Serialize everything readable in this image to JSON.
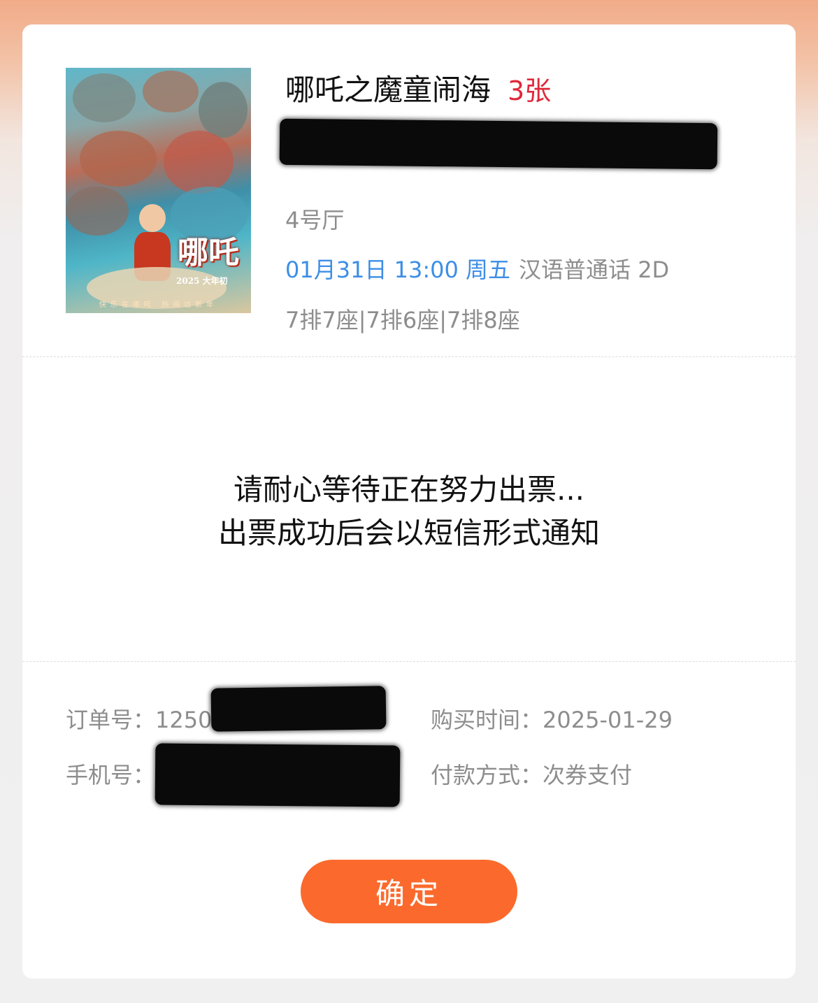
{
  "movie": {
    "title": "哪吒之魔童闹海",
    "ticket_count": "3张",
    "hall": "4号厅",
    "datetime": "01月31日 13:00 周五",
    "language_format": "汉语普通话 2D",
    "seats": "7排7座|7排6座|7排8座",
    "poster": {
      "logo_text": "哪吒",
      "year_text": "2025 大年初",
      "tagline": "快乐在哪吒 热闹过新年"
    }
  },
  "status": {
    "line1": "请耐心等待正在努力出票...",
    "line2": "出票成功后会以短信形式通知"
  },
  "order": {
    "order_no_label": "订单号：",
    "order_no_value": "12501",
    "phone_label": "手机号：",
    "purchase_time_label": "购买时间：",
    "purchase_time_value": "2025-01-29",
    "payment_label": "付款方式：",
    "payment_value": "次券支付"
  },
  "actions": {
    "confirm_label": "确定"
  },
  "colors": {
    "accent": "#fb6a2c",
    "ticket_count": "#e0283a",
    "datetime": "#3d8ee6",
    "secondary_text": "#8d8d8d"
  }
}
